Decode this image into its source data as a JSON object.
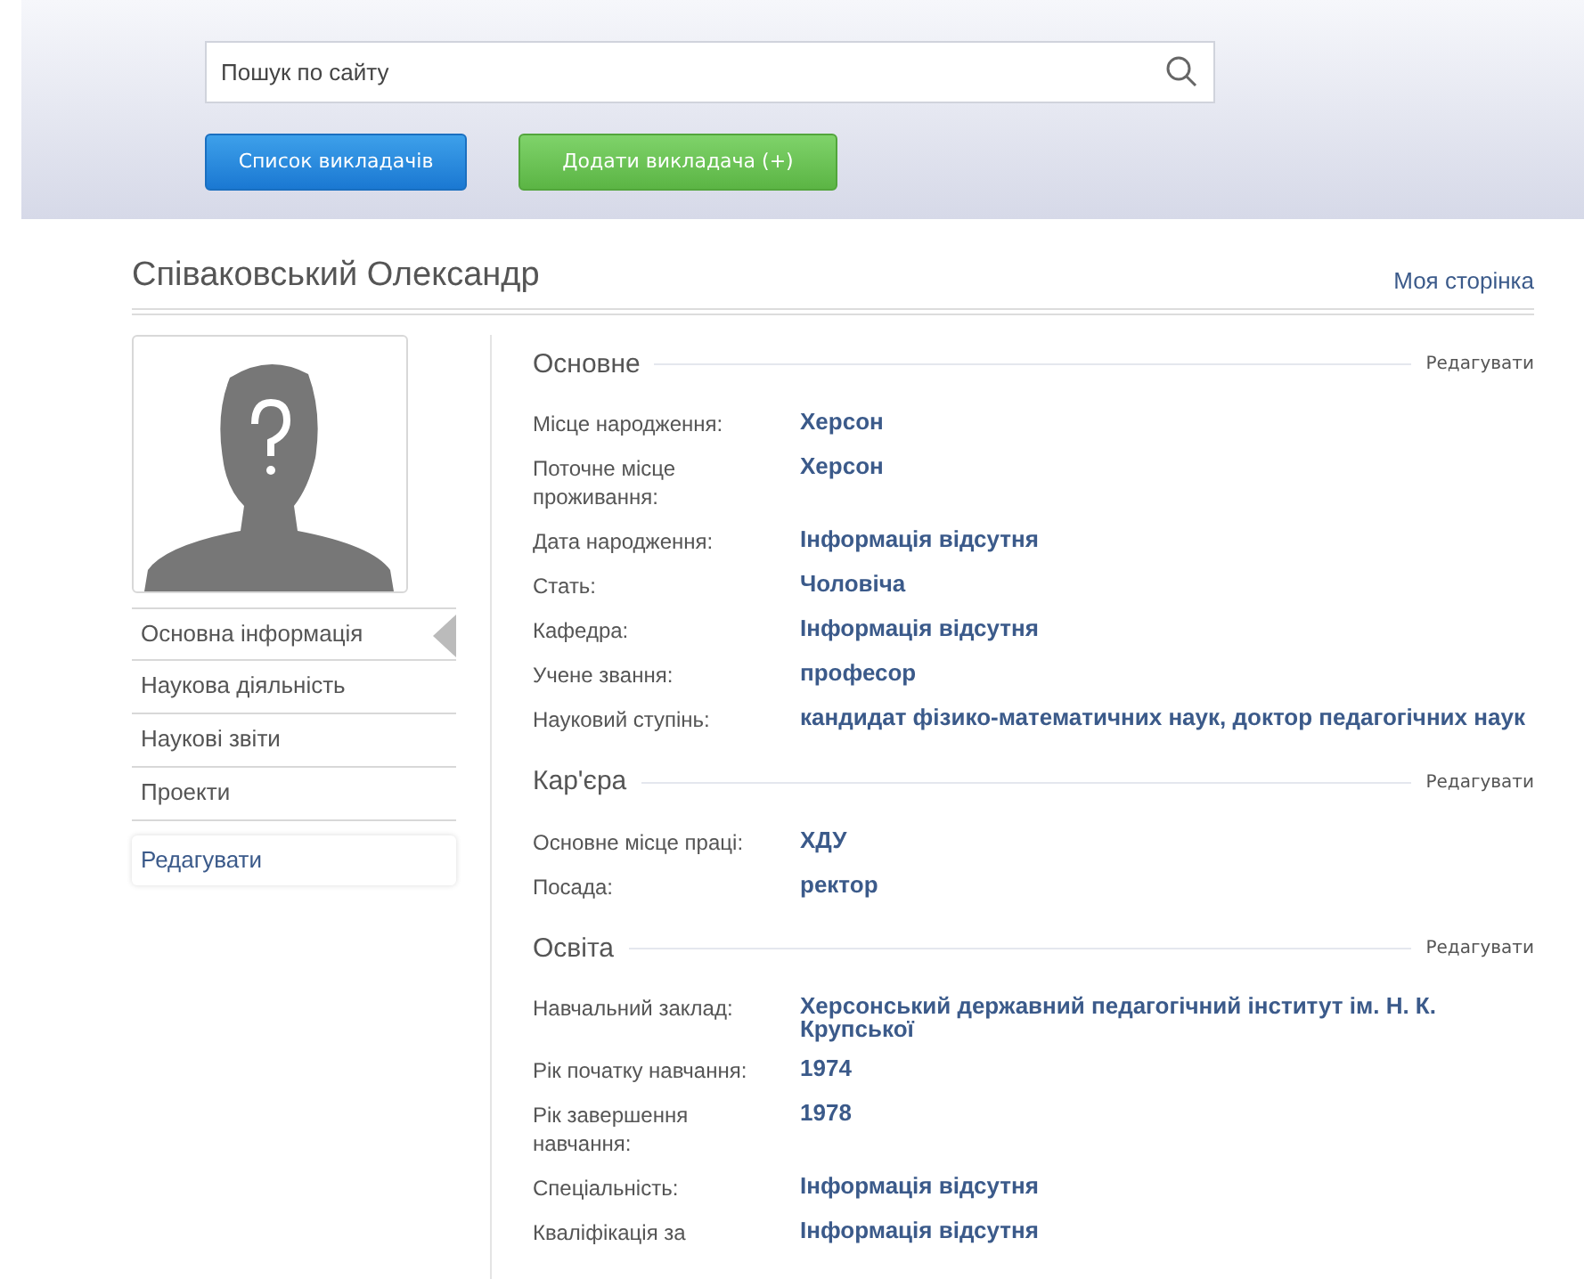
{
  "header": {
    "search": {
      "placeholder": "Пошук по сайту"
    },
    "buttons": [
      {
        "label": "Список викладачів",
        "kind": "primary"
      },
      {
        "label": "Додати викладача (+)",
        "kind": "success"
      }
    ]
  },
  "profile": {
    "name": "Співаковський Олександр",
    "my_page_link": "Моя сторінка"
  },
  "sidebar": {
    "items": [
      {
        "label": "Основна інформація",
        "selected": true
      },
      {
        "label": "Наукова діяльність",
        "selected": false
      },
      {
        "label": "Наукові звіти",
        "selected": false
      },
      {
        "label": "Проекти",
        "selected": false
      }
    ],
    "edit_link": "Редагувати"
  },
  "sections": [
    {
      "title": "Основне",
      "edit": "Редагувати",
      "fields": [
        {
          "label": "Місце народження:",
          "value": "Херсон"
        },
        {
          "label": "Поточне місце проживання:",
          "value": "Херсон"
        },
        {
          "label": "Дата народження:",
          "value": "Інформація відсутня"
        },
        {
          "label": "Стать:",
          "value": "Чоловіча"
        },
        {
          "label": "Кафедра:",
          "value": "Інформація відсутня"
        },
        {
          "label": "Учене звання:",
          "value": "професор"
        },
        {
          "label": "Науковий ступінь:",
          "value": "кандидат фізико-математичних наук, доктор педагогічних наук"
        }
      ]
    },
    {
      "title": "Кар'єра",
      "edit": "Редагувати",
      "fields": [
        {
          "label": "Основне місце праці:",
          "value": "ХДУ"
        },
        {
          "label": "Посада:",
          "value": "ректор"
        }
      ]
    },
    {
      "title": "Освіта",
      "edit": "Редагувати",
      "fields": [
        {
          "label": "Навчальний заклад:",
          "value": "Херсонський державний педагогічний інститут ім. Н. К. Крупської"
        },
        {
          "label": "Рік початку навчання:",
          "value": "1974"
        },
        {
          "label": "Рік завершення навчання:",
          "value": "1978"
        },
        {
          "label": "Спеціальність:",
          "value": "Інформація відсутня"
        },
        {
          "label": "Кваліфікація за",
          "value": "Інформація відсутня"
        }
      ]
    }
  ]
}
